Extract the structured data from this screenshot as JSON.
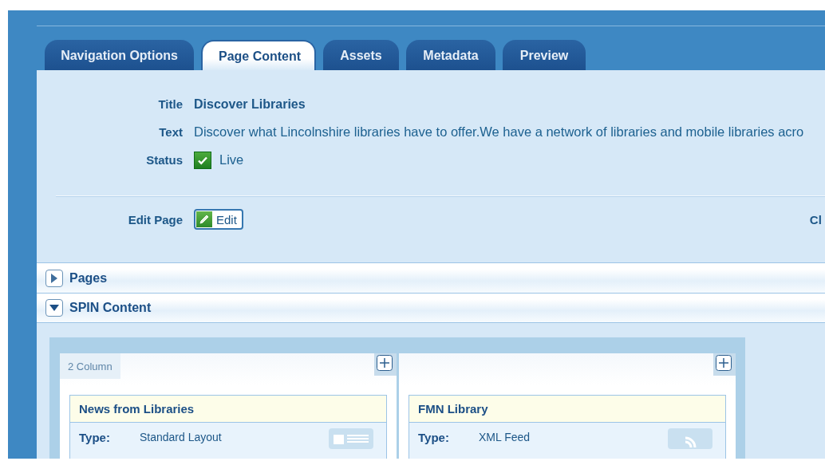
{
  "tabs": [
    {
      "label": "Navigation Options",
      "selected": false
    },
    {
      "label": "Page Content",
      "selected": true
    },
    {
      "label": "Assets",
      "selected": false
    },
    {
      "label": "Metadata",
      "selected": false
    },
    {
      "label": "Preview",
      "selected": false
    }
  ],
  "fields": [
    {
      "kind": "title",
      "label": "Title",
      "value": "Discover Libraries"
    },
    {
      "kind": "text",
      "label": "Text",
      "value": "Discover what Lincolnshire libraries have to offer.We have a network of libraries and mobile libraries acro"
    },
    {
      "kind": "status",
      "label": "Status",
      "checked": true,
      "value": "Live"
    }
  ],
  "edit": {
    "label": "Edit Page",
    "button": "Edit",
    "side_label": "Cl"
  },
  "sections": [
    {
      "label": "Pages",
      "expanded": false
    },
    {
      "label": "SPIN Content",
      "expanded": true
    }
  ],
  "layout": {
    "label": "2 Column",
    "columns": [
      {
        "modules": [
          {
            "kind": "layout",
            "title": "News from Libraries",
            "type_label": "Type:",
            "type_value": "Standard Layout"
          }
        ]
      },
      {
        "modules": [
          {
            "kind": "feed",
            "title": "FMN Library",
            "type_label": "Type:",
            "type_value": "XML Feed"
          }
        ]
      }
    ]
  }
}
